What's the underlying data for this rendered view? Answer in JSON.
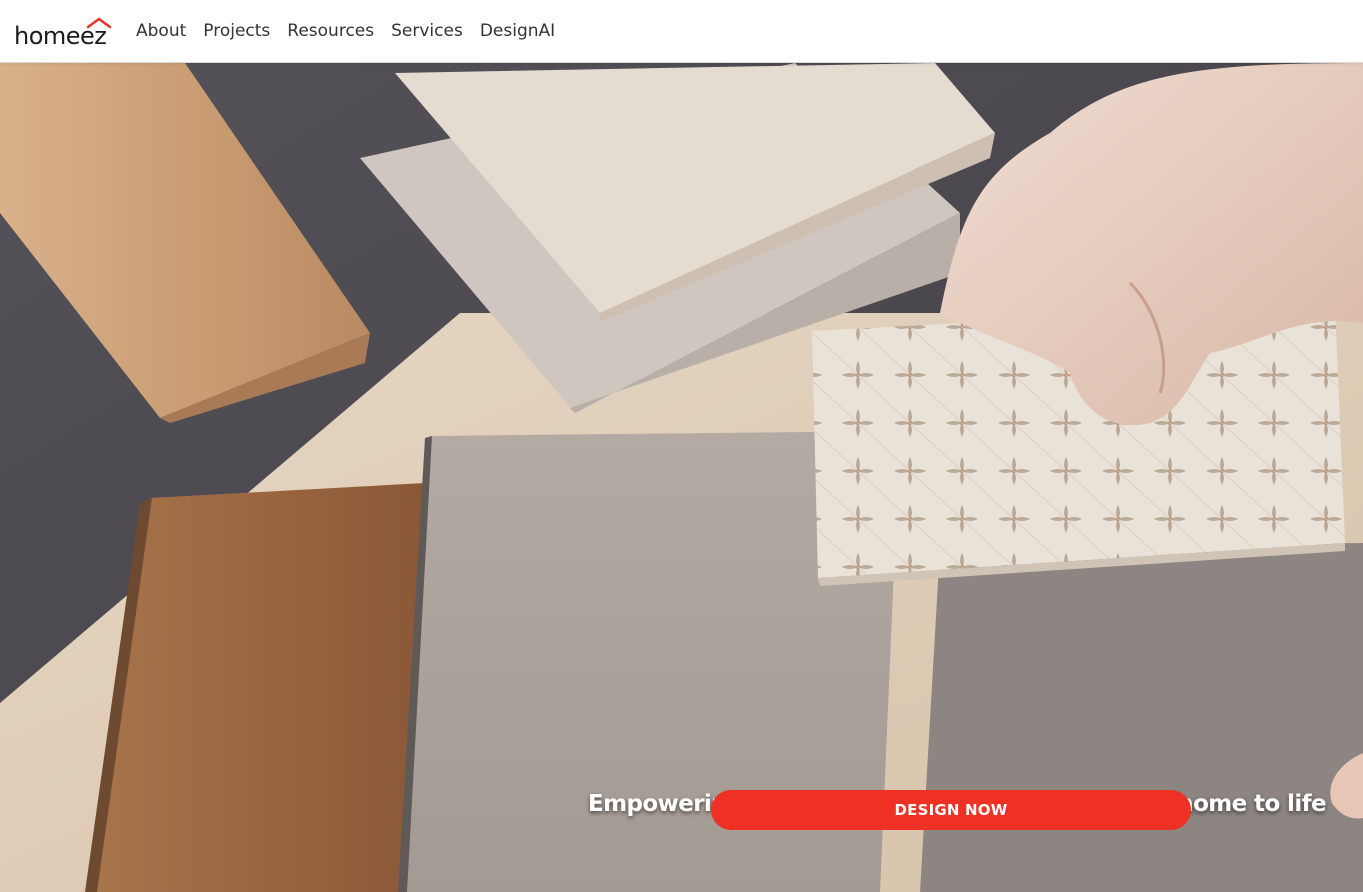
{
  "brand": {
    "logo_text": "homeez",
    "accent_color": "#ee3124"
  },
  "nav": {
    "items": [
      {
        "label": "About"
      },
      {
        "label": "Projects"
      },
      {
        "label": "Resources"
      },
      {
        "label": "Services"
      },
      {
        "label": "DesignAI"
      }
    ]
  },
  "hero": {
    "tagline": "Empowering homeowners to bring their dream home to life",
    "cta_label": "DESIGN NOW",
    "cta_color": "#ee3124"
  },
  "icons": {
    "logo_roof": "house-roof-icon"
  }
}
